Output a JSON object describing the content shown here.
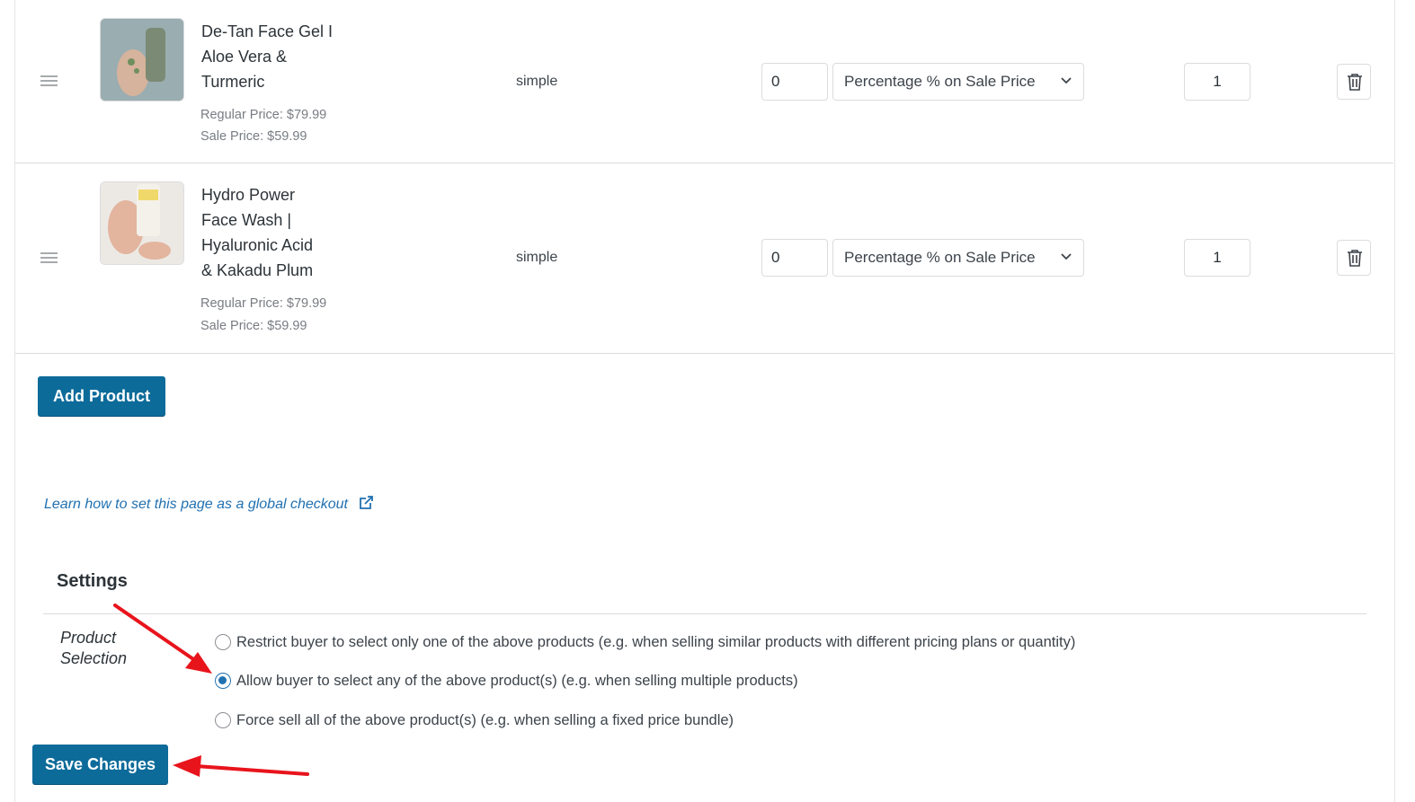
{
  "products": [
    {
      "name_lines": [
        "De-Tan Face Gel I",
        "Aloe Vera &",
        "Turmeric"
      ],
      "regular_price": "Regular Price: $79.99",
      "sale_price": "Sale Price: $59.99",
      "type": "simple",
      "discount_value": "0",
      "discount_type": "Percentage % on Sale Price",
      "quantity": "1"
    },
    {
      "name_lines": [
        "Hydro Power",
        "Face Wash |",
        "Hyaluronic Acid",
        "& Kakadu Plum"
      ],
      "regular_price": "Regular Price: $79.99",
      "sale_price": "Sale Price: $59.99",
      "type": "simple",
      "discount_value": "0",
      "discount_type": "Percentage % on Sale Price",
      "quantity": "1"
    }
  ],
  "add_product_label": "Add Product",
  "learn_link": "Learn how to set this page as a global checkout",
  "settings": {
    "title": "Settings",
    "product_selection_label_lines": [
      "Product",
      "Selection"
    ],
    "options": [
      {
        "label": "Restrict buyer to select only one of the above products (e.g. when selling similar products with different pricing plans or quantity)",
        "checked": false
      },
      {
        "label": "Allow buyer to select any of the above product(s) (e.g. when selling multiple products)",
        "checked": true
      },
      {
        "label": "Force sell all of the above product(s) (e.g. when selling a fixed price bundle)",
        "checked": false
      }
    ]
  },
  "save_changes_label": "Save Changes",
  "colors": {
    "primary": "#0d6b9a",
    "link": "#2271b1",
    "annotation_arrow": "#e8141c"
  },
  "icons": [
    "drag-handle-icon",
    "trash-icon",
    "chevron-down-icon",
    "external-link-icon"
  ]
}
